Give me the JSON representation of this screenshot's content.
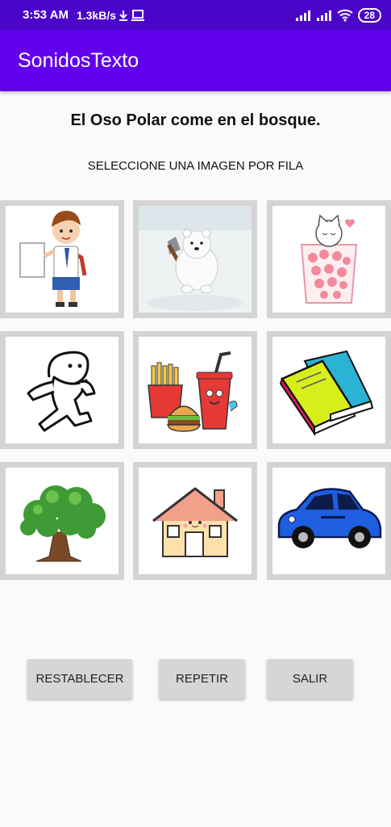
{
  "status_bar": {
    "time": "3:53 AM",
    "net_speed": "1.3kB/s",
    "battery": "28"
  },
  "app_bar": {
    "title": "SonidosTexto"
  },
  "content": {
    "sentence": "El Oso Polar come en el bosque.",
    "instruction": "SELECCIONE UNA IMAGEN POR FILA"
  },
  "image_rows": [
    [
      "schoolboy",
      "polar-bear",
      "cat-in-glass"
    ],
    [
      "walking-figure",
      "fast-food",
      "books"
    ],
    [
      "tree",
      "house",
      "car"
    ]
  ],
  "buttons": {
    "reset": "RESTABLECER",
    "repeat": "REPETIR",
    "exit": "SALIR"
  },
  "colors": {
    "status_bar": "#4a05c8",
    "app_bar": "#6200ee",
    "button": "#d6d6d6",
    "tile_frame": "#d4d4d4"
  }
}
